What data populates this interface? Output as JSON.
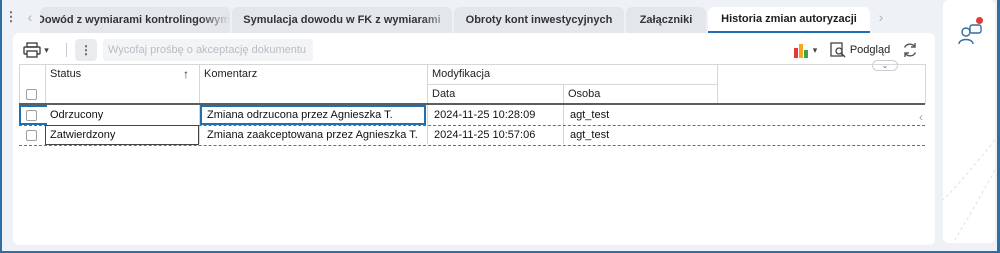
{
  "tabs": [
    {
      "label": "Dowód z wymiarami kontrolingowymi",
      "active": false
    },
    {
      "label": "Symulacja dowodu w FK z wymiarami",
      "active": false
    },
    {
      "label": "Obroty kont inwestycyjnych",
      "active": false
    },
    {
      "label": "Załączniki",
      "active": false
    },
    {
      "label": "Historia zmian autoryzacji",
      "active": true
    }
  ],
  "toolbar": {
    "withdraw_label": "Wycofaj prośbę o akceptację dokumentu",
    "preview_label": "Podgląd",
    "print_icon": "printer-icon",
    "more_icon": "kebab-icon",
    "chart_icon": "bar-chart-icon",
    "refresh_icon": "refresh-icon"
  },
  "grid": {
    "headers": {
      "status": "Status",
      "comment": "Komentarz",
      "modification": "Modyfikacja",
      "date": "Data",
      "person": "Osoba"
    },
    "rows": [
      {
        "status": "Odrzucony",
        "comment": "Zmiana odrzucona przez Agnieszka T.",
        "date": "2024-11-25 10:28:09",
        "person": "agt_test"
      },
      {
        "status": "Zatwierdzony",
        "comment": "Zmiana zaakceptowana przez Agnieszka T.",
        "date": "2024-11-25 10:57:06",
        "person": "agt_test"
      }
    ]
  },
  "colors": {
    "accent": "#1f6fb2",
    "chart_bars": [
      "#e53935",
      "#f5a623",
      "#43a047"
    ],
    "notification": "#e53935"
  }
}
